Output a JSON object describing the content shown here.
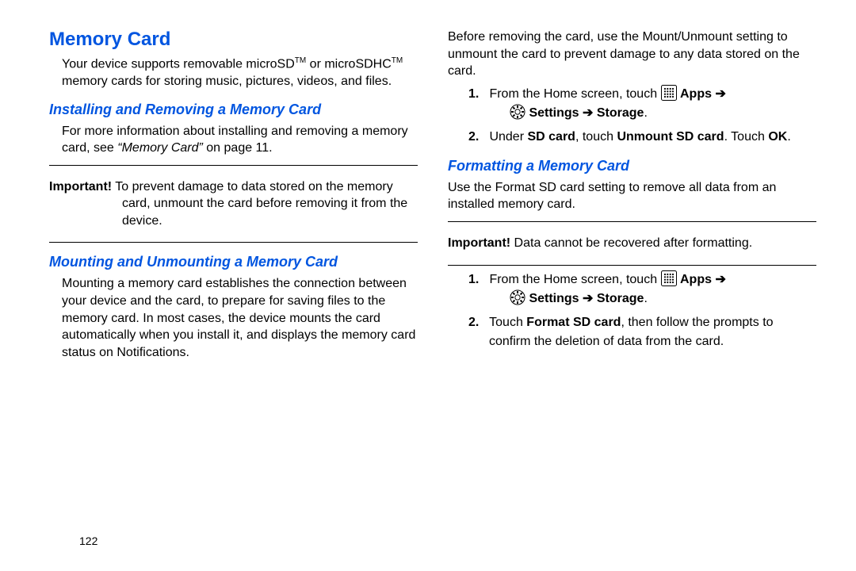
{
  "page_number": "122",
  "left": {
    "title": "Memory Card",
    "intro_a": "Your device supports removable microSD",
    "intro_b": " or microSDHC",
    "intro_c": " memory cards for storing music, pictures, videos, and files.",
    "tm": "TM",
    "sec1_title": "Installing and Removing a Memory Card",
    "sec1_body_a": "For more information about installing and removing a memory card, see ",
    "sec1_body_ref": "“Memory Card”",
    "sec1_body_b": " on page 11.",
    "imp_label": "Important!",
    "imp1_text": " To prevent damage to data stored on the memory card, unmount the card before removing it from the device.",
    "sec2_title": "Mounting and Unmounting a Memory Card",
    "sec2_body": "Mounting a memory card establishes the connection between your device and the card, to prepare for saving files to the memory card. In most cases, the device mounts the card automatically when you install it, and displays the memory card status on Notifications."
  },
  "right": {
    "top_body": "Before removing the card, use the Mount/Unmount setting to unmount the card to prevent damage to any data stored on the card.",
    "step_from_home": "From the Home screen, touch ",
    "apps_label": "Apps",
    "arrow": " ➔ ",
    "settings_label": "Settings",
    "storage_label": "Storage",
    "period": ".",
    "step1b_a": "Under ",
    "step1b_sd": "SD card",
    "step1b_b": ", touch ",
    "step1b_un": "Unmount SD card",
    "step1b_c": ". Touch ",
    "step1b_ok": "OK",
    "sec3_title": "Formatting a Memory Card",
    "sec3_body": "Use the Format SD card setting to remove all data from an installed memory card.",
    "imp2_text": " Data cannot be recovered after formatting.",
    "step2b_a": "Touch ",
    "step2b_fmt": "Format SD card",
    "step2b_b": ", then follow the prompts to confirm the deletion of data from the card."
  }
}
